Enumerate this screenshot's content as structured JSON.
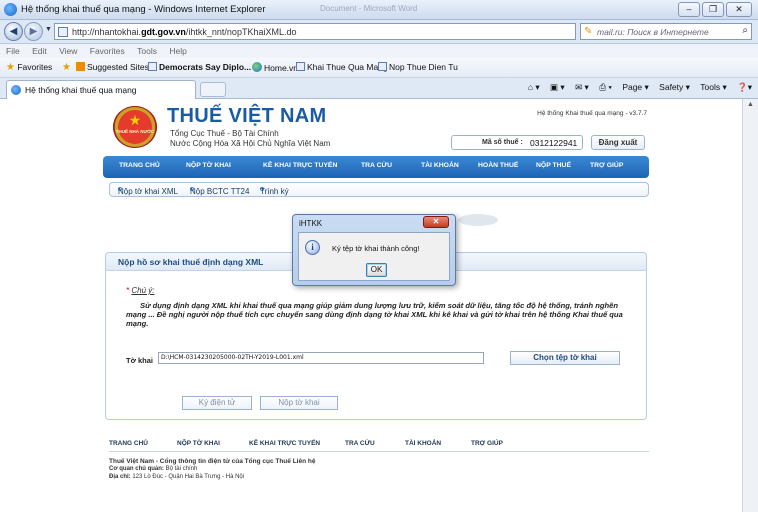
{
  "window": {
    "title": "Hệ thống khai thuế qua mạng - Windows Internet Explorer",
    "ghost_title": "Document - Microsoft Word"
  },
  "address": {
    "url_prefix": "http://nhantokhai.",
    "url_host": "gdt.gov.vn",
    "url_path": "/ihtkk_nnt/nopTKhaiXML.do",
    "search_placeholder": "mail.ru: Поиск в Интернете"
  },
  "menu": [
    "File",
    "Edit",
    "View",
    "Favorites",
    "Tools",
    "Help"
  ],
  "favorites": {
    "label": "Favorites",
    "items": [
      "Suggested Sites ▾",
      "Democrats Say Diplo... ▾",
      "Home.vn",
      "Khai Thue Qua Mang",
      "Nop Thue Dien Tu"
    ]
  },
  "tab": {
    "label": "Hệ thống khai thuế qua mạng"
  },
  "command_bar": [
    "Page ▾",
    "Safety ▾",
    "Tools ▾"
  ],
  "site": {
    "brand": "THUẾ VIỆT NAM",
    "subtitle1": "Tổng Cục Thuế - Bộ Tài Chính",
    "subtitle2": "Nước Cộng Hòa Xã Hội Chủ Nghĩa Việt Nam",
    "seal_text": "THUẾ NHÀ NƯỚC",
    "version": "Hệ thống Khai thuế qua mạng - v3.7.7",
    "mst_label": "Mã số thuế :",
    "mst_value": "0312122941",
    "logout": "Đăng xuất"
  },
  "main_nav": [
    "TRANG CHỦ",
    "NỘP TỜ KHAI",
    "KÊ KHAI TRỰC TUYẾN",
    "TRA CỨU",
    "TÀI KHOẢN",
    "HOÀN THUẾ",
    "NỘP THUẾ",
    "TRỢ GIÚP"
  ],
  "sub_nav": [
    "Nộp tờ khai XML",
    "Nộp BCTC TT24",
    "Trình ký"
  ],
  "panel": {
    "title": "Nộp hồ sơ khai thuế định dạng XML",
    "note_label": "Chú ý:",
    "note_text": "Sử dụng định dạng XML khi khai thuế qua mạng giúp giảm dung lượng lưu trữ, kiểm soát dữ liệu, tăng tốc độ hệ thống, tránh nghẽn mạng ... Đề nghị người nộp thuế tích cực chuyển sang dùng định dạng tờ khai XML khi kê khai và gửi tờ khai trên hệ thống Khai thuế qua mạng.",
    "file_label": "Tờ khai",
    "file_value": "D:\\HCM-0314230205000-02TH-Y2019-L001.xml",
    "choose_button": "Chọn tệp tờ khai",
    "sign_button": "Ký điện tử",
    "submit_button": "Nộp tờ khai"
  },
  "footer": {
    "nav": [
      "TRANG CHỦ",
      "NỘP TỜ KHAI",
      "KÊ KHAI TRỰC TUYẾN",
      "TRA CỨU",
      "TÀI KHOẢN",
      "TRỢ GIÚP"
    ],
    "line1": "Thuế Việt Nam - Cổng thông tin điện tử của Tổng cục Thuế Liên hệ",
    "agency_label": "Cơ quan chủ quản:",
    "agency_value": "Bộ tài chính",
    "address_label": "Địa chỉ:",
    "address_value": "123 Lò Đúc - Quận Hai Bà Trưng - Hà Nội"
  },
  "dialog": {
    "title": "iHTKK",
    "message": "Ký tệp tờ khai thành công!",
    "ok": "OK"
  }
}
